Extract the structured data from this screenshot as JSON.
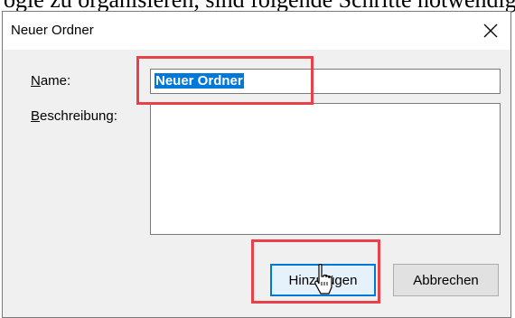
{
  "background_text": "ogie zu organisieren, sind folgende Schritte notwendig:",
  "dialog": {
    "title": "Neuer Ordner",
    "close_glyph": "✕"
  },
  "form": {
    "name_label_accesskey": "N",
    "name_label_rest": "ame:",
    "name_value": "Neuer Ordner",
    "description_label_accesskey": "B",
    "description_label_rest": "eschreibung:",
    "description_value": ""
  },
  "buttons": {
    "add_accesskey": "u",
    "add_before": "Hinz",
    "add_after": "fügen",
    "cancel_label": "Abbrechen"
  },
  "colors": {
    "highlight": "#e8414a",
    "selection": "#0078d7"
  },
  "icons": [
    "close-icon",
    "mouse-cursor-icon"
  ]
}
